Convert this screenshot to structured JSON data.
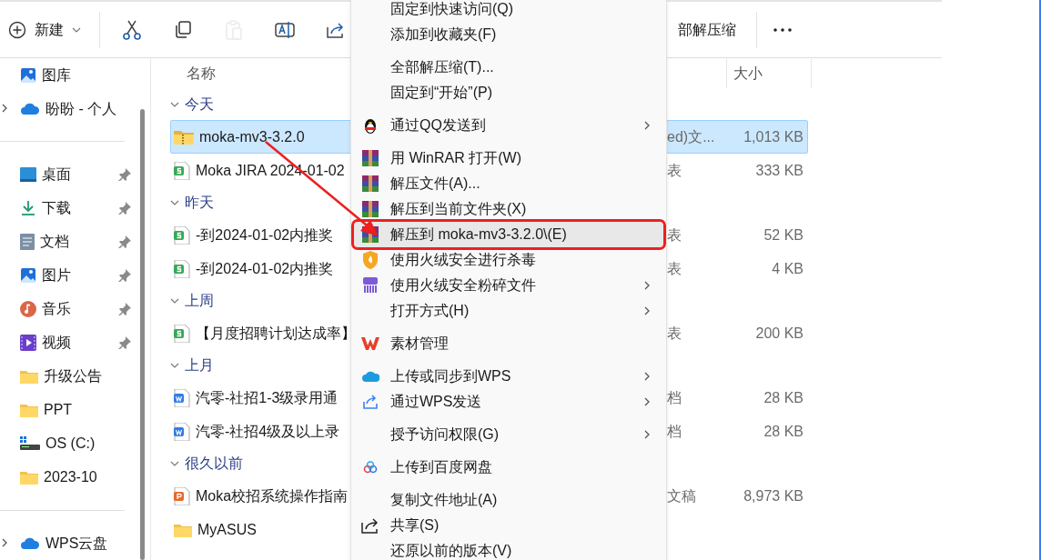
{
  "toolbar": {
    "new_label": "新建",
    "buttons": [
      {
        "disabled": false
      },
      {
        "disabled": false
      },
      {
        "disabled": true
      },
      {
        "disabled": false
      },
      {
        "disabled": false
      }
    ],
    "extract_all_label": "部解压缩"
  },
  "sidebar": {
    "items": [
      {
        "kind": "gallery",
        "label": "图库",
        "pinned": false,
        "expandable": false
      },
      {
        "kind": "cloud",
        "label": "盼盼 - 个人",
        "pinned": false,
        "expandable": true
      },
      {
        "kind": "divider"
      },
      {
        "kind": "desktop",
        "label": "桌面",
        "pinned": true,
        "expandable": false
      },
      {
        "kind": "download",
        "label": "下载",
        "pinned": true,
        "expandable": false
      },
      {
        "kind": "document",
        "label": "文档",
        "pinned": true,
        "expandable": false
      },
      {
        "kind": "gallery",
        "label": "图片",
        "pinned": true,
        "expandable": false
      },
      {
        "kind": "music",
        "label": "音乐",
        "pinned": true,
        "expandable": false
      },
      {
        "kind": "video",
        "label": "视频",
        "pinned": true,
        "expandable": false
      },
      {
        "kind": "folder",
        "label": "升级公告",
        "pinned": false,
        "expandable": false
      },
      {
        "kind": "folder",
        "label": "PPT",
        "pinned": false,
        "expandable": false
      },
      {
        "kind": "drive",
        "label": "OS (C:)",
        "pinned": false,
        "expandable": false
      },
      {
        "kind": "folder",
        "label": "2023-10",
        "pinned": false,
        "expandable": false
      },
      {
        "kind": "divider"
      },
      {
        "kind": "cloud",
        "label": "WPS云盘",
        "pinned": false,
        "expandable": true
      }
    ]
  },
  "columns": [
    "名称",
    "大小"
  ],
  "groups": [
    {
      "label": "今天",
      "files": [
        {
          "kind": "zip",
          "name": "moka-mv3-3.2.0",
          "type": "ed)文...",
          "size": "1,013 KB",
          "selected": true
        },
        {
          "kind": "sheet",
          "name": "Moka JIRA 2024-01-02",
          "type": "表",
          "size": "333 KB",
          "selected": false
        }
      ]
    },
    {
      "label": "昨天",
      "files": [
        {
          "kind": "sheet",
          "name": "-到2024-01-02内推奖",
          "type": "表",
          "size": "52 KB",
          "selected": false
        },
        {
          "kind": "sheet",
          "name": "-到2024-01-02内推奖",
          "type": "表",
          "size": "4 KB",
          "selected": false
        }
      ]
    },
    {
      "label": "上周",
      "files": [
        {
          "kind": "sheet",
          "name": "【月度招聘计划达成率】",
          "type": "表",
          "size": "200 KB",
          "selected": false
        }
      ]
    },
    {
      "label": "上月",
      "files": [
        {
          "kind": "word",
          "name": "汽零-社招1-3级录用通",
          "type": "档",
          "size": "28 KB",
          "selected": false
        },
        {
          "kind": "word",
          "name": "汽零-社招4级及以上录",
          "type": "档",
          "size": "28 KB",
          "selected": false
        }
      ]
    },
    {
      "label": "很久以前",
      "files": [
        {
          "kind": "ppt",
          "name": "Moka校招系统操作指南",
          "type": "文稿",
          "size": "8,973 KB",
          "selected": false
        },
        {
          "kind": "folder",
          "name": "MyASUS",
          "selected": false
        }
      ]
    }
  ],
  "context_menu": {
    "items": [
      {
        "kind": "plain",
        "label": "固定到快速访问(Q)",
        "submenu": false,
        "highlighted": false
      },
      {
        "kind": "plain",
        "label": "添加到收藏夹(F)",
        "submenu": false,
        "highlighted": false
      },
      {
        "kind": "separator"
      },
      {
        "kind": "plain",
        "label": "全部解压缩(T)...",
        "submenu": false,
        "highlighted": false
      },
      {
        "kind": "plain",
        "label": "固定到“开始”(P)",
        "submenu": false,
        "highlighted": false
      },
      {
        "kind": "separator"
      },
      {
        "kind": "penguin",
        "label": "通过QQ发送到",
        "submenu": true,
        "highlighted": false
      },
      {
        "kind": "separator"
      },
      {
        "kind": "books",
        "label": "用 WinRAR 打开(W)",
        "submenu": false,
        "highlighted": false
      },
      {
        "kind": "books",
        "label": "解压文件(A)...",
        "submenu": false,
        "highlighted": false
      },
      {
        "kind": "books",
        "label": "解压到当前文件夹(X)",
        "submenu": false,
        "highlighted": false
      },
      {
        "kind": "books",
        "label": "解压到 moka-mv3-3.2.0\\(E)",
        "submenu": false,
        "highlighted": true,
        "annotated": true
      },
      {
        "kind": "shield",
        "label": "使用火绒安全进行杀毒",
        "submenu": false,
        "highlighted": false
      },
      {
        "kind": "shredder",
        "label": "使用火绒安全粉碎文件",
        "submenu": true,
        "highlighted": false
      },
      {
        "kind": "plain",
        "label": "打开方式(H)",
        "submenu": true,
        "highlighted": false
      },
      {
        "kind": "separator"
      },
      {
        "kind": "wlogo",
        "label": "素材管理",
        "submenu": false,
        "highlighted": false
      },
      {
        "kind": "separator"
      },
      {
        "kind": "cloud",
        "label": "上传或同步到WPS",
        "submenu": true,
        "highlighted": false
      },
      {
        "kind": "sendblue",
        "label": "通过WPS发送",
        "submenu": true,
        "highlighted": false
      },
      {
        "kind": "separator"
      },
      {
        "kind": "plain",
        "label": "授予访问权限(G)",
        "submenu": true,
        "highlighted": false
      },
      {
        "kind": "separator"
      },
      {
        "kind": "rings",
        "label": "上传到百度网盘",
        "submenu": false,
        "highlighted": false
      },
      {
        "kind": "separator"
      },
      {
        "kind": "plain",
        "label": "复制文件地址(A)",
        "submenu": false,
        "highlighted": false
      },
      {
        "kind": "share",
        "label": "共享(S)",
        "submenu": false,
        "highlighted": false
      },
      {
        "kind": "plain",
        "label": "还原以前的版本(V)",
        "submenu": false,
        "highlighted": false
      }
    ]
  },
  "annotation_arrow": true
}
